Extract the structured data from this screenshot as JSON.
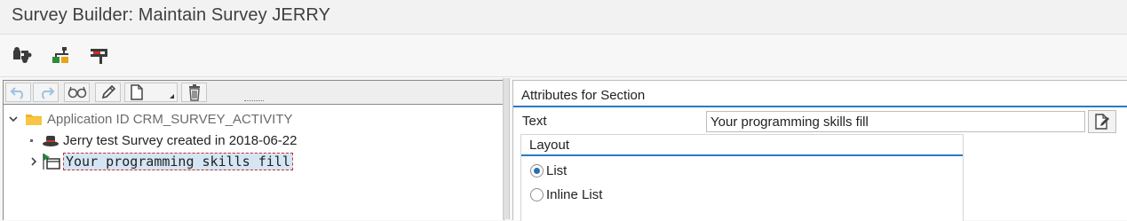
{
  "window": {
    "title": "Survey Builder: Maintain Survey JERRY"
  },
  "app_toolbar": {
    "buttons": [
      {
        "icon": "puzzle-icon"
      },
      {
        "icon": "hierarchy-icon"
      },
      {
        "icon": "tool-icon"
      }
    ]
  },
  "tree_toolbar": {
    "buttons": [
      {
        "icon": "undo-icon"
      },
      {
        "icon": "redo-icon"
      },
      {
        "icon": "display-glasses-icon"
      },
      {
        "icon": "pencil-icon"
      },
      {
        "icon": "create-document-icon"
      },
      {
        "icon": "delete-icon"
      }
    ]
  },
  "tree": {
    "root": {
      "label": "Application ID CRM_SURVEY_ACTIVITY",
      "expanded": true
    },
    "children": [
      {
        "label": "Jerry test Survey created in 2018-06-22",
        "icon": "survey-hat-icon"
      },
      {
        "label": "Your programming skills fill",
        "icon": "section-icon",
        "selected": true
      }
    ]
  },
  "attributes": {
    "header": "Attributes for Section",
    "text_label": "Text",
    "text_value": "Your programming skills fill",
    "layout": {
      "title": "Layout",
      "options": [
        {
          "label": "List",
          "selected": true
        },
        {
          "label": "Inline List",
          "selected": false
        }
      ]
    }
  },
  "colors": {
    "accent": "#2a7ac0",
    "selection_bg": "#d4e6f3",
    "selection_border": "#d42a2a",
    "folder": "#f0b429"
  }
}
